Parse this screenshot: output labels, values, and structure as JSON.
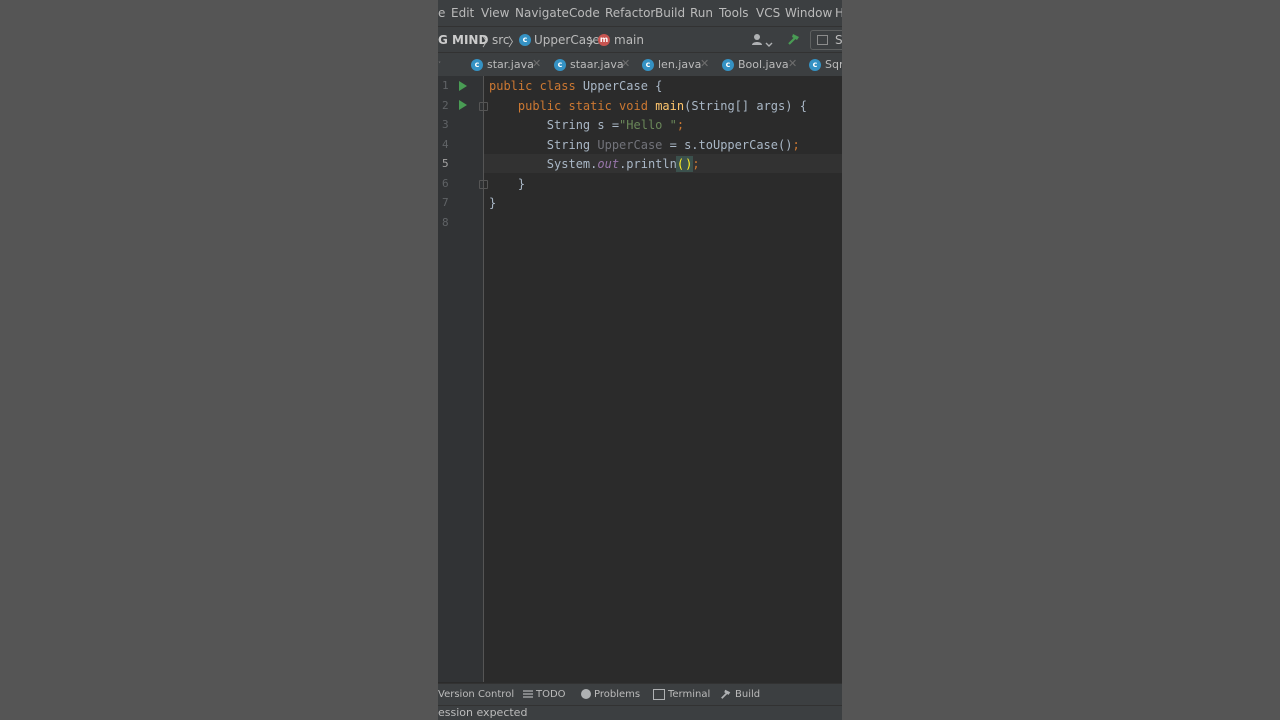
{
  "menu": {
    "items": [
      "e",
      "Edit",
      "View",
      "Navigate",
      "Code",
      "Refactor",
      "Build",
      "Run",
      "Tools",
      "VCS",
      "Window",
      "H"
    ]
  },
  "nav": {
    "project": "G MIND",
    "src": "src",
    "class_name": "UpperCase",
    "method": "main",
    "separator": "〉",
    "run_config_partial": "S"
  },
  "tabs": [
    {
      "label": "star.java"
    },
    {
      "label": "staar.java"
    },
    {
      "label": "len.java"
    },
    {
      "label": "Bool.java"
    },
    {
      "label": "Sqr"
    }
  ],
  "editor": {
    "line_numbers": [
      "1",
      "2",
      "3",
      "4",
      "5",
      "6",
      "7",
      "8"
    ],
    "current_line": 5
  },
  "code": {
    "l1_kw": "public class ",
    "l1_rest": "UpperCase {",
    "l2_indent": "    ",
    "l2_kw": "public static void ",
    "l2_fn": "main",
    "l2_rest": "(String[] args) {",
    "l3_indent": "        ",
    "l3_type": "String s =",
    "l3_str": "\"Hello \"",
    "l3_semi": ";",
    "l4_indent": "        ",
    "l4_type": "String ",
    "l4_var": "UpperCase",
    "l4_rest": " = s.toUpperCase()",
    "l4_semi": ";",
    "l5_indent": "        ",
    "l5_a": "System.",
    "l5_out": "out",
    "l5_b": ".println",
    "l5_open": "(",
    "l5_close": ")",
    "l5_semi": ";",
    "l6": "    }",
    "l7": "}"
  },
  "toolwindows": {
    "version_control": "Version Control",
    "todo": "TODO",
    "problems": "Problems",
    "terminal": "Terminal",
    "build": "Build"
  },
  "status": {
    "message": "ession expected"
  },
  "colors": {
    "keyword": "#cc7832",
    "string": "#6a8759",
    "function": "#ffc66d",
    "run_icon": "#499c54",
    "class_icon": "#3592c4"
  }
}
